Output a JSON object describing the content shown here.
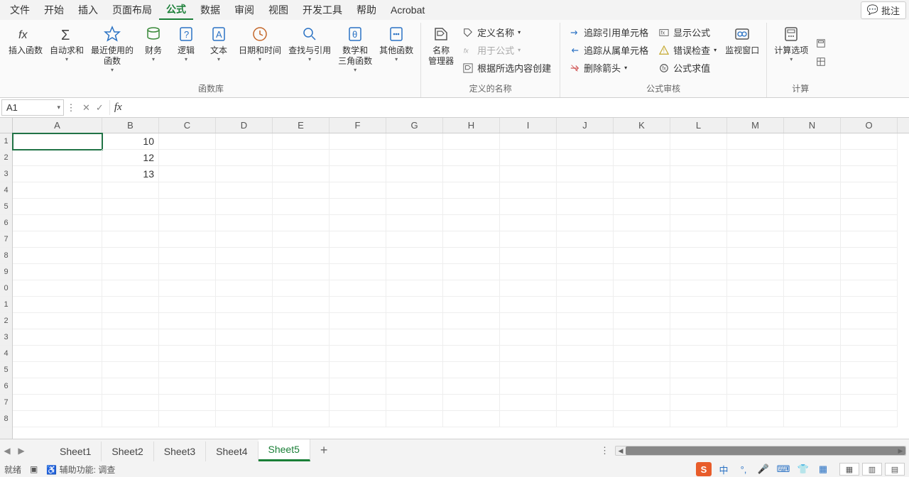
{
  "menubar": {
    "items": [
      "文件",
      "开始",
      "插入",
      "页面布局",
      "公式",
      "数据",
      "审阅",
      "视图",
      "开发工具",
      "帮助",
      "Acrobat"
    ],
    "active_index": 4,
    "annotate": "批注"
  },
  "ribbon": {
    "groups": [
      {
        "label": "函数库",
        "buttons": [
          {
            "label": "插入函数",
            "icon": "fx-icon",
            "dd": false
          },
          {
            "label": "自动求和",
            "icon": "sigma-icon",
            "dd": true
          },
          {
            "label": "最近使用的\n函数",
            "icon": "star-icon",
            "dd": true
          },
          {
            "label": "财务",
            "icon": "db-icon",
            "dd": true
          },
          {
            "label": "逻辑",
            "icon": "question-icon",
            "dd": true
          },
          {
            "label": "文本",
            "icon": "text-icon",
            "dd": true
          },
          {
            "label": "日期和时间",
            "icon": "clock-icon",
            "dd": true
          },
          {
            "label": "查找与引用",
            "icon": "search-icon",
            "dd": true
          },
          {
            "label": "数学和\n三角函数",
            "icon": "theta-icon",
            "dd": true
          },
          {
            "label": "其他函数",
            "icon": "ellipsis-icon",
            "dd": true
          }
        ]
      },
      {
        "label": "定义的名称",
        "buttons_big": [
          {
            "label": "名称\n管理器",
            "icon": "tag-box-icon",
            "dd": false
          }
        ],
        "rows": [
          {
            "label": "定义名称",
            "icon": "tag-icon",
            "dd": true,
            "disabled": false
          },
          {
            "label": "用于公式",
            "icon": "fx-small-icon",
            "dd": true,
            "disabled": true
          },
          {
            "label": "根据所选内容创建",
            "icon": "tag-create-icon",
            "dd": false,
            "disabled": false
          }
        ]
      },
      {
        "label": "公式审核",
        "rows": [
          {
            "label": "追踪引用单元格",
            "icon": "trace-precedent-icon"
          },
          {
            "label": "追踪从属单元格",
            "icon": "trace-dependent-icon"
          },
          {
            "label": "删除箭头",
            "icon": "remove-arrow-icon",
            "dd": true
          }
        ],
        "rows2": [
          {
            "label": "显示公式",
            "icon": "show-formula-icon"
          },
          {
            "label": "错误检查",
            "icon": "error-check-icon",
            "dd": true
          },
          {
            "label": "公式求值",
            "icon": "evaluate-icon"
          }
        ],
        "buttons_big": [
          {
            "label": "监视窗口",
            "icon": "watch-icon"
          }
        ]
      },
      {
        "label": "计算",
        "buttons_big": [
          {
            "label": "计算选项",
            "icon": "calc-options-icon",
            "dd": true
          }
        ],
        "rows": [
          {
            "label": "",
            "icon": "calc-now-icon"
          },
          {
            "label": "",
            "icon": "calc-sheet-icon"
          }
        ]
      }
    ]
  },
  "namebox": "A1",
  "formula_value": "",
  "columns": [
    "A",
    "B",
    "C",
    "D",
    "E",
    "F",
    "G",
    "H",
    "I",
    "J",
    "K",
    "L",
    "M",
    "N",
    "O"
  ],
  "row_numbers_visible": [
    "1",
    "2",
    "3",
    "4",
    "5",
    "6",
    "7",
    "8",
    "9",
    "0",
    "1",
    "2",
    "3",
    "4",
    "5",
    "6",
    "7",
    "8"
  ],
  "cells": {
    "B1": "10",
    "B2": "12",
    "B3": "13"
  },
  "active_cell": "A1",
  "sheets": {
    "tabs": [
      "Sheet1",
      "Sheet2",
      "Sheet3",
      "Sheet4",
      "Sheet5"
    ],
    "active_index": 4
  },
  "status": {
    "ready": "就绪",
    "accessibility": "辅助功能: 调查",
    "ime": {
      "logo": "S",
      "lang": "中"
    }
  }
}
